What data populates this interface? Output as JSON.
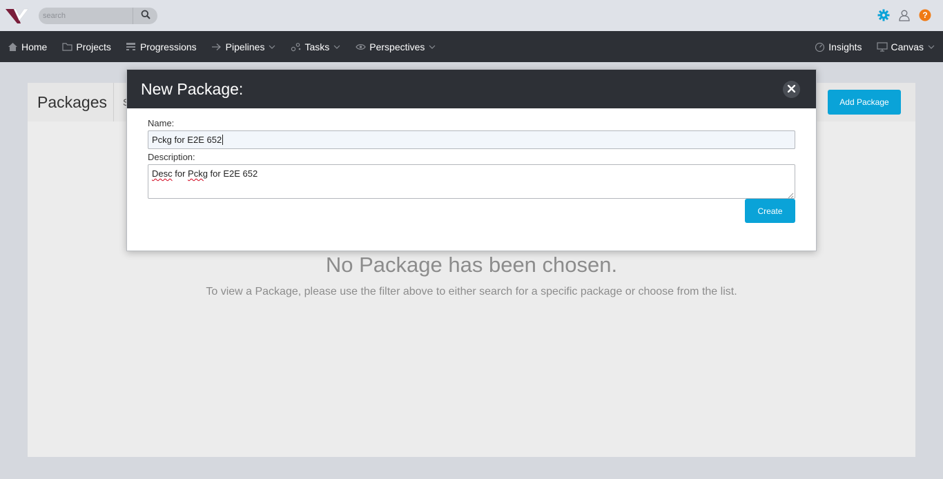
{
  "search": {
    "placeholder": "search"
  },
  "nav": {
    "left": [
      {
        "label": "Home",
        "icon": "home-icon"
      },
      {
        "label": "Projects",
        "icon": "folder-icon"
      },
      {
        "label": "Progressions",
        "icon": "progressions-icon"
      },
      {
        "label": "Pipelines",
        "icon": "arrow-right-icon"
      },
      {
        "label": "Tasks",
        "icon": "tasks-icon"
      },
      {
        "label": "Perspectives",
        "icon": "eye-icon"
      }
    ],
    "right": [
      {
        "label": "Insights",
        "icon": "gauge-icon"
      },
      {
        "label": "Canvas",
        "icon": "monitor-icon"
      }
    ]
  },
  "panel": {
    "title": "Packages",
    "subtitle_fragment": "S",
    "add_button": "Add Package",
    "empty_title": "No Package has been chosen.",
    "empty_desc": "To view a Package, please use the filter above to either search for a specific package or choose from the list."
  },
  "modal": {
    "title": "New Package:",
    "name_label": "Name:",
    "name_value": "Pckg for E2E 652",
    "description_label": "Description:",
    "desc_word1": "Desc",
    "desc_mid": " for ",
    "desc_word2": "Pckg",
    "desc_rest": " for E2E 652",
    "create_button": "Create"
  },
  "colors": {
    "accent": "#0aa3d8",
    "nav_bg": "#2d3036",
    "help_orange": "#f07a14",
    "logo_maroon": "#7a1e3a"
  }
}
